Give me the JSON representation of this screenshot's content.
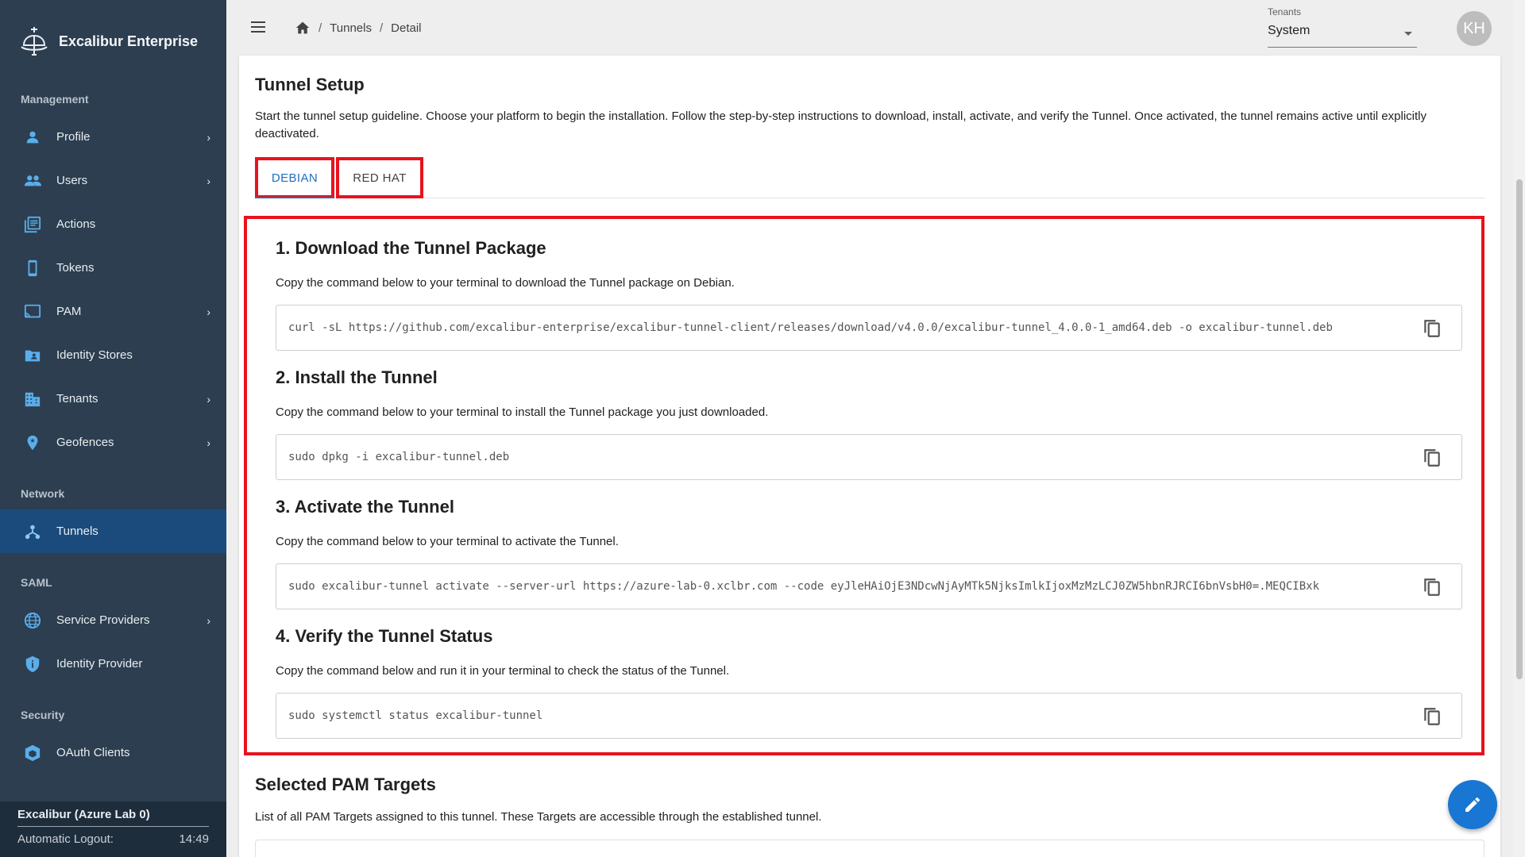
{
  "app": {
    "brand": "Excalibur Enterprise"
  },
  "sidebar": {
    "sections": [
      {
        "title": "Management"
      },
      {
        "title": "Network"
      },
      {
        "title": "SAML"
      },
      {
        "title": "Security"
      }
    ],
    "items": [
      {
        "label": "Profile",
        "icon": "person-icon",
        "has_chevron": true
      },
      {
        "label": "Users",
        "icon": "group-icon",
        "has_chevron": true
      },
      {
        "label": "Actions",
        "icon": "list-icon",
        "has_chevron": false
      },
      {
        "label": "Tokens",
        "icon": "phone-icon",
        "has_chevron": false
      },
      {
        "label": "PAM",
        "icon": "cast-icon",
        "has_chevron": true
      },
      {
        "label": "Identity Stores",
        "icon": "folder-user-icon",
        "has_chevron": false
      },
      {
        "label": "Tenants",
        "icon": "building-icon",
        "has_chevron": true
      },
      {
        "label": "Geofences",
        "icon": "location-pin-icon",
        "has_chevron": true
      },
      {
        "label": "Tunnels",
        "icon": "tunnel-icon",
        "has_chevron": false,
        "active": true
      },
      {
        "label": "Service Providers",
        "icon": "globe-icon",
        "has_chevron": true
      },
      {
        "label": "Identity Provider",
        "icon": "shield-icon",
        "has_chevron": false
      },
      {
        "label": "OAuth Clients",
        "icon": "cube-icon",
        "has_chevron": false
      }
    ],
    "footer": {
      "title": "Excalibur (Azure Lab 0)",
      "logout_label": "Automatic Logout:",
      "logout_time": "14:49"
    }
  },
  "topbar": {
    "breadcrumbs": [
      "Tunnels",
      "Detail"
    ],
    "tenants_label": "Tenants",
    "tenants_value": "System",
    "avatar_initials": "KH"
  },
  "setup": {
    "title": "Tunnel Setup",
    "description": "Start the tunnel setup guideline. Choose your platform to begin the installation. Follow the step-by-step instructions to download, install, activate, and verify the Tunnel. Once activated, the tunnel remains active until explicitly deactivated.",
    "tabs": [
      "DEBIAN",
      "RED HAT"
    ],
    "steps": [
      {
        "title": "1. Download the Tunnel Package",
        "description": "Copy the command below to your terminal to download the Tunnel package on Debian.",
        "command": "curl -sL https://github.com/excalibur-enterprise/excalibur-tunnel-client/releases/download/v4.0.0/excalibur-tunnel_4.0.0-1_amd64.deb -o excalibur-tunnel.deb"
      },
      {
        "title": "2. Install the Tunnel",
        "description": "Copy the command below to your terminal to install the Tunnel package you just downloaded.",
        "command": "sudo dpkg -i excalibur-tunnel.deb"
      },
      {
        "title": "3. Activate the Tunnel",
        "description": "Copy the command below to your terminal to activate the Tunnel.",
        "command": "sudo excalibur-tunnel activate --server-url https://azure-lab-0.xclbr.com --code eyJleHAiOjE3NDcwNjAyMTk5NjksImlkIjoxMzMzLCJ0ZW5hbnRJRCI6bnVsbH0=.MEQCIBxk"
      },
      {
        "title": "4. Verify the Tunnel Status",
        "description": "Copy the command below and run it in your terminal to check the status of the Tunnel.",
        "command": "sudo systemctl status excalibur-tunnel"
      }
    ]
  },
  "targets": {
    "title": "Selected PAM Targets",
    "description": "List of all PAM Targets assigned to this tunnel. These Targets are accessible through the established tunnel."
  },
  "colors": {
    "sidebar_bg": "#2c3e50",
    "sidebar_active": "#1b4b7c",
    "accent": "#1976d2",
    "highlight_border": "#e8121d"
  }
}
